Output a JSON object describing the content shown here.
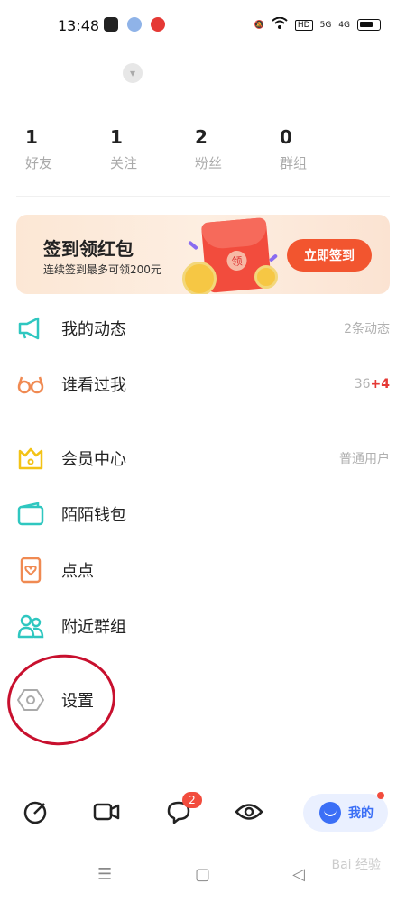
{
  "status_bar": {
    "time": "13:48",
    "signal_labels": [
      "HD",
      "5G",
      "4G"
    ]
  },
  "stats": [
    {
      "num": "1",
      "label": "好友"
    },
    {
      "num": "1",
      "label": "关注"
    },
    {
      "num": "2",
      "label": "粉丝"
    },
    {
      "num": "0",
      "label": "群组"
    }
  ],
  "banner": {
    "title": "签到领红包",
    "subtitle": "连续签到最多可领200元",
    "packet_char": "领",
    "button": "立即签到"
  },
  "menu": {
    "dynamics": {
      "label": "我的动态",
      "right": "2条动态"
    },
    "visitors": {
      "label": "谁看过我",
      "count": "36",
      "delta": "+4"
    },
    "vip": {
      "label": "会员中心",
      "right": "普通用户"
    },
    "wallet": {
      "label": "陌陌钱包"
    },
    "dots": {
      "label": "点点"
    },
    "nearby_groups": {
      "label": "附近群组"
    },
    "settings": {
      "label": "设置"
    }
  },
  "tabbar": {
    "messages_badge": "2",
    "mine_label": "我的"
  },
  "watermark": "Bai 经验",
  "colors": {
    "accent_blue": "#3b6ff6",
    "badge_red": "#f24c3d",
    "button_orange": "#f2552f",
    "circle_red": "#c8102e",
    "teal": "#2fc7c0",
    "orange_icon": "#f08a52",
    "yellow_icon": "#f3c316"
  }
}
